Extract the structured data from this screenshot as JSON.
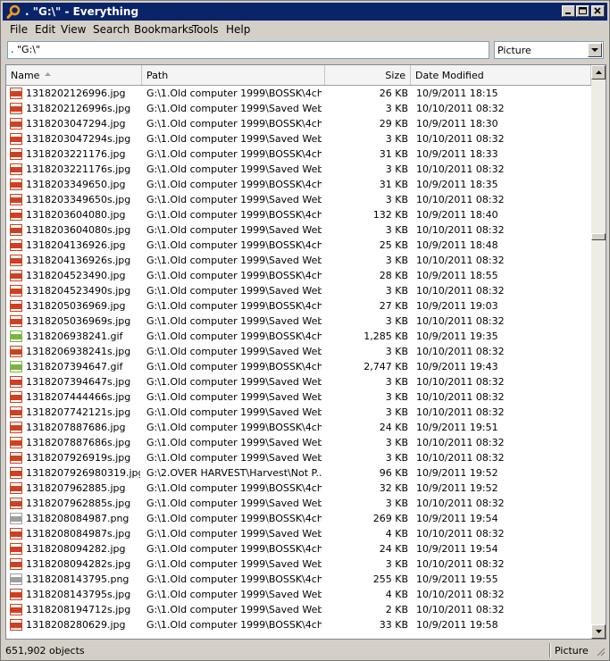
{
  "window": {
    "title": ". \"G:\\\" - Everything"
  },
  "menu": [
    "File",
    "Edit",
    "View",
    "Search",
    "Bookmarks",
    "Tools",
    "Help"
  ],
  "search": {
    "value": ". \"G:\\\""
  },
  "filter": {
    "selected": "Picture"
  },
  "columns": {
    "name": "Name",
    "path": "Path",
    "size": "Size",
    "date": "Date Modified"
  },
  "files": [
    {
      "name": "1318202126996.jpg",
      "path": "G:\\1.Old computer 1999\\BOSSK\\4cha...",
      "size": "26 KB",
      "date": "10/9/2011 18:15",
      "type": "jpg"
    },
    {
      "name": "1318202126996s.jpg",
      "path": "G:\\1.Old computer 1999\\Saved Webp...",
      "size": "3 KB",
      "date": "10/10/2011 08:32",
      "type": "jpg"
    },
    {
      "name": "1318203047294.jpg",
      "path": "G:\\1.Old computer 1999\\BOSSK\\4cha...",
      "size": "29 KB",
      "date": "10/9/2011 18:30",
      "type": "jpg"
    },
    {
      "name": "1318203047294s.jpg",
      "path": "G:\\1.Old computer 1999\\Saved Webp...",
      "size": "3 KB",
      "date": "10/10/2011 08:32",
      "type": "jpg"
    },
    {
      "name": "1318203221176.jpg",
      "path": "G:\\1.Old computer 1999\\BOSSK\\4cha...",
      "size": "31 KB",
      "date": "10/9/2011 18:33",
      "type": "jpg"
    },
    {
      "name": "1318203221176s.jpg",
      "path": "G:\\1.Old computer 1999\\Saved Webp...",
      "size": "3 KB",
      "date": "10/10/2011 08:32",
      "type": "jpg"
    },
    {
      "name": "1318203349650.jpg",
      "path": "G:\\1.Old computer 1999\\BOSSK\\4cha...",
      "size": "31 KB",
      "date": "10/9/2011 18:35",
      "type": "jpg"
    },
    {
      "name": "1318203349650s.jpg",
      "path": "G:\\1.Old computer 1999\\Saved Webp...",
      "size": "3 KB",
      "date": "10/10/2011 08:32",
      "type": "jpg"
    },
    {
      "name": "1318203604080.jpg",
      "path": "G:\\1.Old computer 1999\\BOSSK\\4cha...",
      "size": "132 KB",
      "date": "10/9/2011 18:40",
      "type": "jpg"
    },
    {
      "name": "1318203604080s.jpg",
      "path": "G:\\1.Old computer 1999\\Saved Webp...",
      "size": "3 KB",
      "date": "10/10/2011 08:32",
      "type": "jpg"
    },
    {
      "name": "1318204136926.jpg",
      "path": "G:\\1.Old computer 1999\\BOSSK\\4cha...",
      "size": "25 KB",
      "date": "10/9/2011 18:48",
      "type": "jpg"
    },
    {
      "name": "1318204136926s.jpg",
      "path": "G:\\1.Old computer 1999\\Saved Webp...",
      "size": "3 KB",
      "date": "10/10/2011 08:32",
      "type": "jpg"
    },
    {
      "name": "1318204523490.jpg",
      "path": "G:\\1.Old computer 1999\\BOSSK\\4cha...",
      "size": "28 KB",
      "date": "10/9/2011 18:55",
      "type": "jpg"
    },
    {
      "name": "1318204523490s.jpg",
      "path": "G:\\1.Old computer 1999\\Saved Webp...",
      "size": "3 KB",
      "date": "10/10/2011 08:32",
      "type": "jpg"
    },
    {
      "name": "1318205036969.jpg",
      "path": "G:\\1.Old computer 1999\\BOSSK\\4cha...",
      "size": "27 KB",
      "date": "10/9/2011 19:03",
      "type": "jpg"
    },
    {
      "name": "1318205036969s.jpg",
      "path": "G:\\1.Old computer 1999\\Saved Webp...",
      "size": "3 KB",
      "date": "10/10/2011 08:32",
      "type": "jpg"
    },
    {
      "name": "1318206938241.gif",
      "path": "G:\\1.Old computer 1999\\BOSSK\\4cha...",
      "size": "1,285 KB",
      "date": "10/9/2011 19:35",
      "type": "gif"
    },
    {
      "name": "1318206938241s.jpg",
      "path": "G:\\1.Old computer 1999\\Saved Webp...",
      "size": "3 KB",
      "date": "10/10/2011 08:32",
      "type": "jpg"
    },
    {
      "name": "1318207394647.gif",
      "path": "G:\\1.Old computer 1999\\BOSSK\\4cha...",
      "size": "2,747 KB",
      "date": "10/9/2011 19:43",
      "type": "gif"
    },
    {
      "name": "1318207394647s.jpg",
      "path": "G:\\1.Old computer 1999\\Saved Webp...",
      "size": "3 KB",
      "date": "10/10/2011 08:32",
      "type": "jpg"
    },
    {
      "name": "1318207444466s.jpg",
      "path": "G:\\1.Old computer 1999\\Saved Webp...",
      "size": "3 KB",
      "date": "10/10/2011 08:32",
      "type": "jpg"
    },
    {
      "name": "1318207742121s.jpg",
      "path": "G:\\1.Old computer 1999\\Saved Webp...",
      "size": "3 KB",
      "date": "10/10/2011 08:32",
      "type": "jpg"
    },
    {
      "name": "1318207887686.jpg",
      "path": "G:\\1.Old computer 1999\\BOSSK\\4cha...",
      "size": "24 KB",
      "date": "10/9/2011 19:51",
      "type": "jpg"
    },
    {
      "name": "1318207887686s.jpg",
      "path": "G:\\1.Old computer 1999\\Saved Webp...",
      "size": "3 KB",
      "date": "10/10/2011 08:32",
      "type": "jpg"
    },
    {
      "name": "1318207926919s.jpg",
      "path": "G:\\1.Old computer 1999\\Saved Webp...",
      "size": "3 KB",
      "date": "10/10/2011 08:32",
      "type": "jpg"
    },
    {
      "name": "1318207926980319.jpg",
      "path": "G:\\2.OVER HARVEST\\Harvest\\Not P...",
      "size": "96 KB",
      "date": "10/9/2011 19:52",
      "type": "jpg"
    },
    {
      "name": "1318207962885.jpg",
      "path": "G:\\1.Old computer 1999\\BOSSK\\4cha...",
      "size": "32 KB",
      "date": "10/9/2011 19:52",
      "type": "jpg"
    },
    {
      "name": "1318207962885s.jpg",
      "path": "G:\\1.Old computer 1999\\Saved Webp...",
      "size": "3 KB",
      "date": "10/10/2011 08:32",
      "type": "jpg"
    },
    {
      "name": "1318208084987.png",
      "path": "G:\\1.Old computer 1999\\BOSSK\\4cha...",
      "size": "269 KB",
      "date": "10/9/2011 19:54",
      "type": "png"
    },
    {
      "name": "1318208084987s.jpg",
      "path": "G:\\1.Old computer 1999\\Saved Webp...",
      "size": "4 KB",
      "date": "10/10/2011 08:32",
      "type": "jpg"
    },
    {
      "name": "1318208094282.jpg",
      "path": "G:\\1.Old computer 1999\\BOSSK\\4cha...",
      "size": "24 KB",
      "date": "10/9/2011 19:54",
      "type": "jpg"
    },
    {
      "name": "1318208094282s.jpg",
      "path": "G:\\1.Old computer 1999\\Saved Webp...",
      "size": "3 KB",
      "date": "10/10/2011 08:32",
      "type": "jpg"
    },
    {
      "name": "1318208143795.png",
      "path": "G:\\1.Old computer 1999\\BOSSK\\4cha...",
      "size": "255 KB",
      "date": "10/9/2011 19:55",
      "type": "png"
    },
    {
      "name": "1318208143795s.jpg",
      "path": "G:\\1.Old computer 1999\\Saved Webp...",
      "size": "4 KB",
      "date": "10/10/2011 08:32",
      "type": "jpg"
    },
    {
      "name": "1318208194712s.jpg",
      "path": "G:\\1.Old computer 1999\\Saved Webp...",
      "size": "2 KB",
      "date": "10/10/2011 08:32",
      "type": "jpg"
    },
    {
      "name": "1318208280629.jpg",
      "path": "G:\\1.Old computer 1999\\BOSSK\\4cha...",
      "size": "33 KB",
      "date": "10/9/2011 19:58",
      "type": "jpg"
    }
  ],
  "status": {
    "count": "651,902 objects",
    "filter": "Picture"
  },
  "colors": {
    "titlebar": "#0a246a",
    "jpg_icon": "#d04020",
    "gif_icon": "#7cb342",
    "png_icon": "#9e9e9e"
  }
}
